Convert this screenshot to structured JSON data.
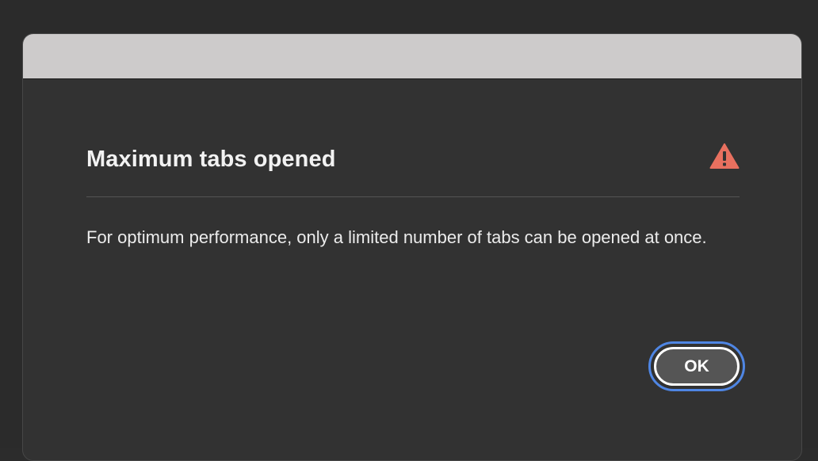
{
  "dialog": {
    "title": "Maximum tabs opened",
    "message": "For optimum performance, only a limited number of tabs can be opened at once.",
    "ok_label": "OK",
    "icon": "alert-triangle-icon"
  },
  "colors": {
    "alert_icon": "#e8705f",
    "focus_ring": "#4f86e4",
    "dialog_background": "#323232",
    "titlebar_background": "#cdcbcb"
  }
}
